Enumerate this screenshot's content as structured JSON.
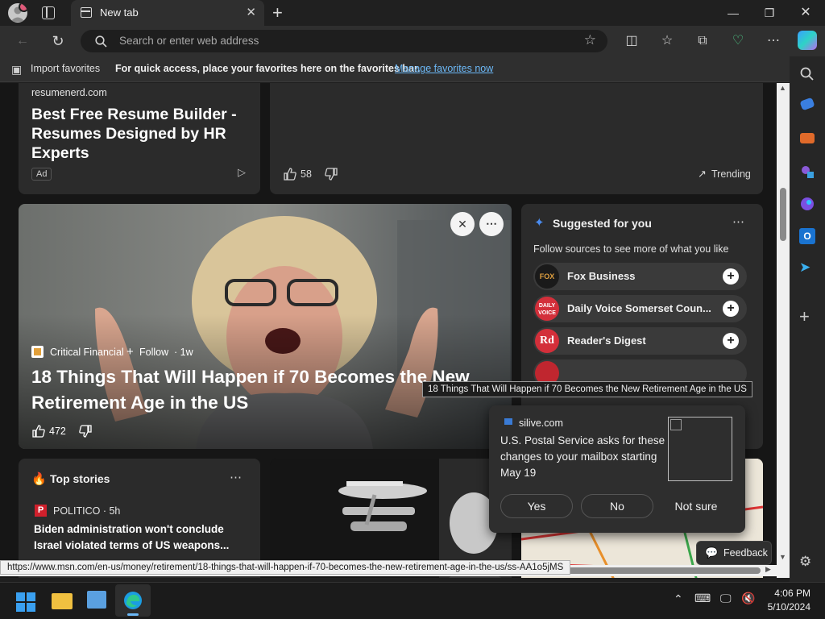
{
  "browser": {
    "tab_title": "New tab",
    "search_placeholder": "Search or enter web address"
  },
  "favorites_bar": {
    "import_label": "Import favorites",
    "hint_text": "For quick access, place your favorites here on the favorites bar.",
    "manage_link": "Manage favorites now"
  },
  "ad_card": {
    "source": "resumenerd.com",
    "title": "Best Free Resume Builder - Resumes Designed by HR Experts",
    "badge": "Ad"
  },
  "trending_card": {
    "likes": "58",
    "trending_label": "Trending"
  },
  "hero": {
    "source": "Critical Financial",
    "follow_label": "Follow",
    "age": "· 1w",
    "title": "18 Things That Will Happen if 70 Becomes the New Retirement Age in the US",
    "likes": "472",
    "tooltip": "18 Things That Will Happen if 70 Becomes the New Retirement Age in the US"
  },
  "suggested": {
    "title": "Suggested for you",
    "subtitle": "Follow sources to see more of what you like",
    "sources": [
      {
        "name": "Fox Business"
      },
      {
        "name": "Daily Voice Somerset Coun..."
      },
      {
        "name": "Reader's Digest"
      }
    ]
  },
  "survey": {
    "source": "silive.com",
    "headline": "U.S. Postal Service asks for these changes to your mailbox starting May 19",
    "yes": "Yes",
    "no": "No",
    "not_sure": "Not sure"
  },
  "top_stories": {
    "title": "Top stories",
    "source": "POLITICO · 5h",
    "headline": "Biden administration won't conclude Israel violated terms of US weapons..."
  },
  "feedback_label": "Feedback",
  "status_url": "https://www.msn.com/en-us/money/retirement/18-things-that-will-happen-if-70-becomes-the-new-retirement-age-in-the-us/ss-AA1o5jMS",
  "taskbar": {
    "time": "4:06 PM",
    "date": "5/10/2024"
  },
  "colors": {
    "accent_link": "#6cb8f6",
    "survey_bg": "#2e2e2e",
    "page_bg": "#161616"
  }
}
